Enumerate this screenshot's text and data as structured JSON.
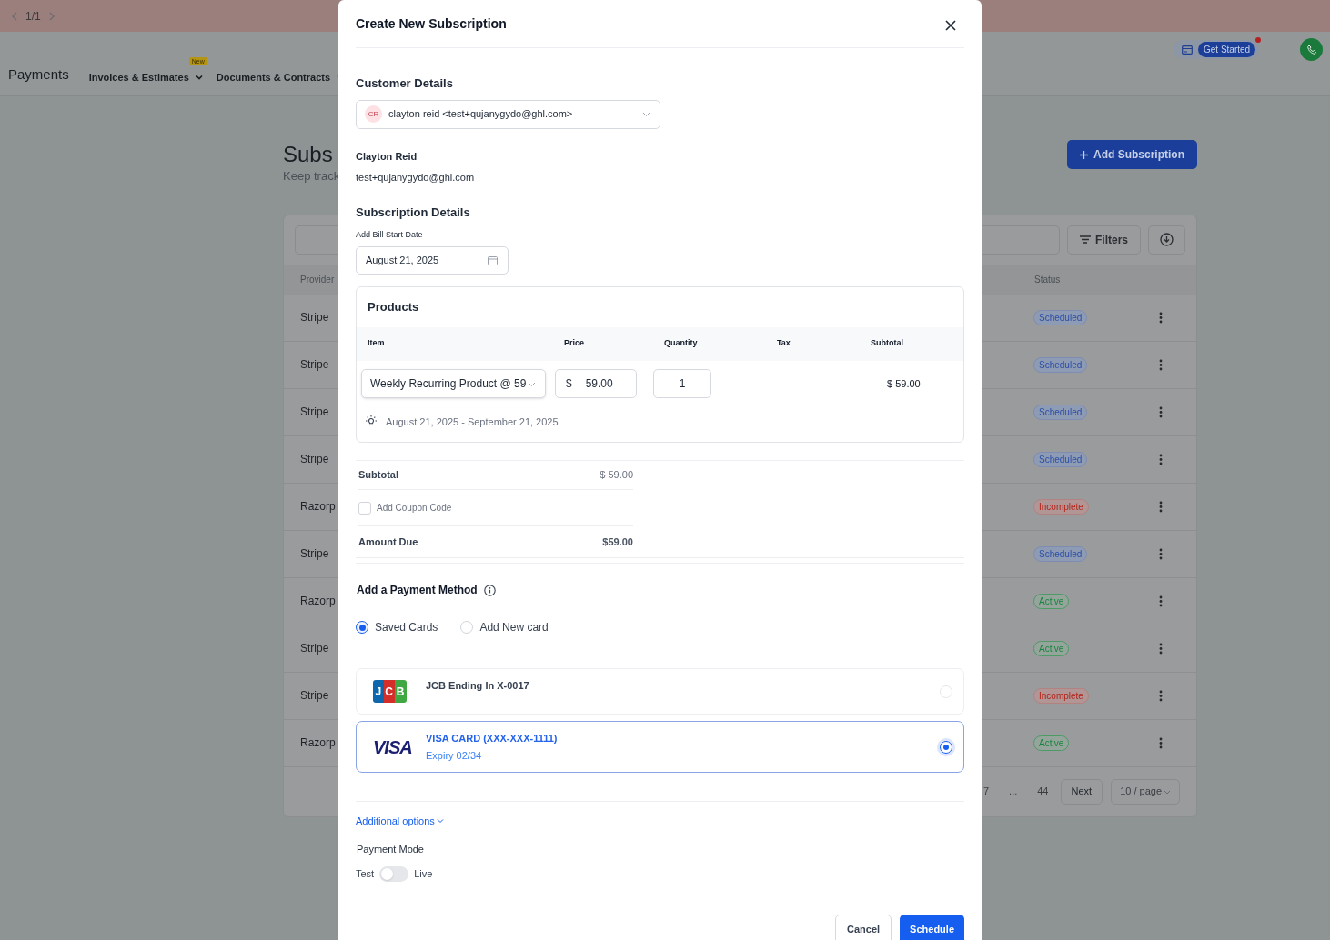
{
  "top_bar": {
    "pager": "1/1"
  },
  "nav": {
    "title": "Payments",
    "items": [
      {
        "label": "Invoices & Estimates",
        "badge": "New"
      },
      {
        "label": "Documents & Contracts"
      }
    ],
    "get_started": "Get Started"
  },
  "page": {
    "title": "Subs",
    "subtitle": "Keep track",
    "add_button": "Add Subscription",
    "filters": "Filters",
    "columns": [
      "Provider",
      "Status"
    ],
    "rows": [
      {
        "provider": "Stripe",
        "status": "Scheduled",
        "kind": "scheduled"
      },
      {
        "provider": "Stripe",
        "status": "Scheduled",
        "kind": "scheduled"
      },
      {
        "provider": "Stripe",
        "status": "Scheduled",
        "kind": "scheduled"
      },
      {
        "provider": "Stripe",
        "status": "Scheduled",
        "kind": "scheduled"
      },
      {
        "provider": "Razorp",
        "status": "Incomplete",
        "kind": "incomplete"
      },
      {
        "provider": "Stripe",
        "status": "Scheduled",
        "kind": "scheduled"
      },
      {
        "provider": "Razorp",
        "status": "Active",
        "kind": "active"
      },
      {
        "provider": "Stripe",
        "status": "Active",
        "kind": "active"
      },
      {
        "provider": "Stripe",
        "status": "Incomplete",
        "kind": "incomplete"
      },
      {
        "provider": "Razorp",
        "status": "Active",
        "kind": "active"
      }
    ],
    "pagination": [
      "7",
      "...",
      "44"
    ],
    "next": "Next",
    "page_size": "10 / page"
  },
  "modal": {
    "title": "Create New Subscription",
    "customer_heading": "Customer Details",
    "customer_select": {
      "initials": "CR",
      "value": "clayton reid <test+qujanygydo@ghl.com>"
    },
    "customer_name": "Clayton Reid",
    "customer_email": "test+qujanygydo@ghl.com",
    "subscription_heading": "Subscription Details",
    "start_date_label": "Add Bill Start Date",
    "start_date": "August 21, 2025",
    "products": {
      "title": "Products",
      "columns": [
        "Item",
        "Price",
        "Quantity",
        "Tax",
        "Subtotal"
      ],
      "row": {
        "item": "Weekly Recurring Product @ 59",
        "currency": "$",
        "price": "59.00",
        "quantity": "1",
        "tax": "-",
        "subtotal": "$ 59.00"
      },
      "period": "August 21, 2025 - September 21, 2025"
    },
    "subtotal": {
      "label": "Subtotal",
      "value": "$ 59.00"
    },
    "coupon": {
      "label": "Add Coupon Code",
      "checked": false
    },
    "amount_due": {
      "label": "Amount Due",
      "value": "$59.00"
    },
    "payment_heading": "Add a Payment Method",
    "payment_options": [
      {
        "label": "Saved Cards",
        "selected": true
      },
      {
        "label": "Add New card",
        "selected": false
      }
    ],
    "cards": [
      {
        "kind": "jcb",
        "logo": "JCB",
        "title": "JCB Ending In X-0017",
        "selected": false
      },
      {
        "kind": "visa",
        "logo": "VISA",
        "title": "VISA CARD (XXX-XXX-1111)",
        "expiry": "Expiry 02/34",
        "selected": true
      }
    ],
    "additional_options": "Additional options",
    "payment_mode": {
      "label": "Payment Mode",
      "off_label": "Test",
      "on_label": "Live",
      "on": false
    },
    "buttons": {
      "cancel": "Cancel",
      "confirm": "Schedule"
    }
  }
}
